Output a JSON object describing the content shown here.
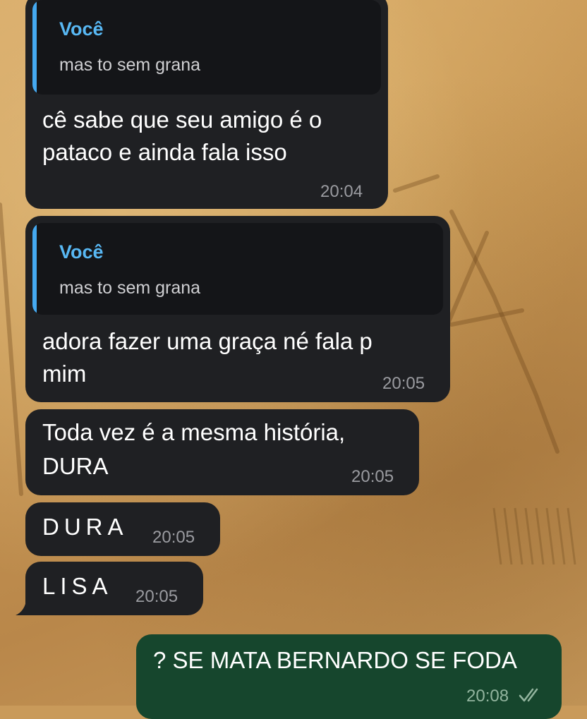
{
  "messages": [
    {
      "direction": "incoming",
      "reply": {
        "author": "Você",
        "text": "mas to sem grana"
      },
      "lines": [
        "cê sabe que seu amigo é o",
        "pataco e ainda fala isso"
      ],
      "time": "20:04"
    },
    {
      "direction": "incoming",
      "reply": {
        "author": "Você",
        "text": "mas to sem grana"
      },
      "lines": [
        "adora fazer uma graça né fala p",
        "mim"
      ],
      "time": "20:05"
    },
    {
      "direction": "incoming",
      "lines": [
        "Toda vez é a mesma história,",
        "DURA"
      ],
      "time": "20:05"
    },
    {
      "direction": "incoming",
      "lines": [
        "DURA"
      ],
      "time": "20:05"
    },
    {
      "direction": "incoming",
      "lines": [
        "LISA"
      ],
      "time": "20:05"
    },
    {
      "direction": "outgoing",
      "lines": [
        "? SE MATA BERNARDO SE FODA"
      ],
      "time": "20:08",
      "status_icon": "double-check-icon"
    }
  ],
  "colors": {
    "incoming_bubble": "#1f2023",
    "outgoing_bubble": "#16462d",
    "reply_accent": "#45a9f0",
    "reply_author": "#58b8f4"
  }
}
